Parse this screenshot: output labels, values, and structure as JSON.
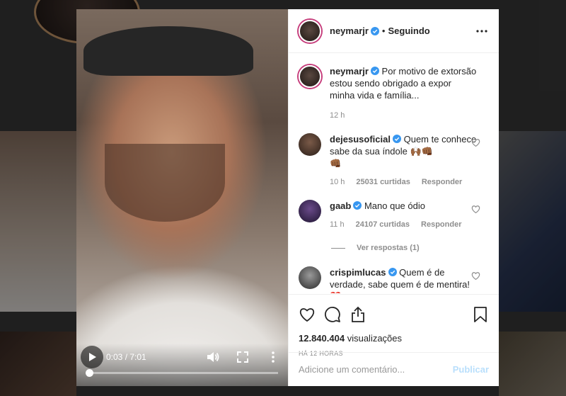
{
  "post": {
    "username": "neymarjr",
    "follow_state": "Seguindo",
    "caption": "Por motivo de extorsão estou sendo obrigado a expor minha vida e família...",
    "caption_time": "12 h",
    "views_count": "12.840.404",
    "views_label": "visualizações",
    "posted_ago": "HÁ 12 HORAS"
  },
  "video": {
    "current_time": "0:03",
    "duration": "7:01",
    "time_display": "0:03 / 7:01",
    "progress_fraction": 0.0071
  },
  "comments": [
    {
      "username": "dejesusoficial",
      "text": "Quem te conhece sabe da sua índole 🙌🏾👊🏾",
      "extra": "👊🏾",
      "time": "10 h",
      "likes": "25031 curtidas",
      "reply": "Responder"
    },
    {
      "username": "gaab",
      "text": "Mano que ódio",
      "time": "11 h",
      "likes": "24107 curtidas",
      "reply": "Responder",
      "view_replies": "Ver respostas (1)"
    },
    {
      "username": "crispimlucas",
      "text": "Quem é de verdade, sabe quem é de mentira!",
      "extra": "❤️"
    }
  ],
  "add_comment": {
    "placeholder": "Adicione um comentário...",
    "publish": "Publicar"
  },
  "colors": {
    "verified": "#3897f0",
    "story_ring": "#c63e7c",
    "publish_disabled": "#b9dffc"
  },
  "icons": [
    "play-icon",
    "volume-icon",
    "fullscreen-icon",
    "more-vertical-icon",
    "more-horizontal-icon",
    "verified-icon",
    "heart-icon",
    "comment-icon",
    "share-icon",
    "bookmark-icon"
  ]
}
